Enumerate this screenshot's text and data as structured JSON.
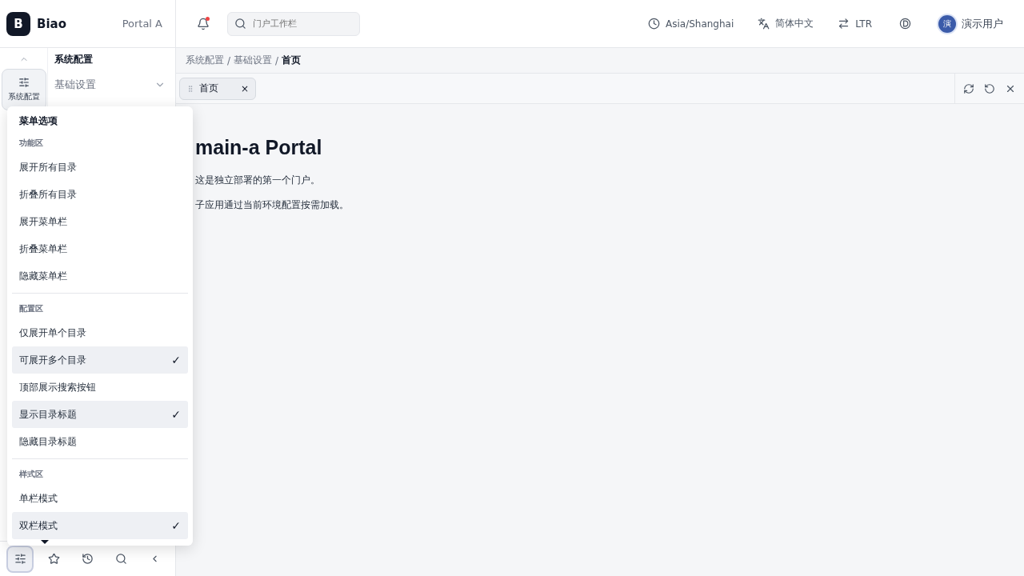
{
  "brand": {
    "logo": "B",
    "name": "Biao",
    "portal": "Portal A"
  },
  "header": {
    "notification_unread": true,
    "search": {
      "placeholder": "门户工作栏"
    },
    "timezone": "Asia/Shanghai",
    "language": "简体中文",
    "direction": "LTR",
    "user": {
      "avatar": "演",
      "name": "演示用户"
    }
  },
  "rail": {
    "items": [
      {
        "label": "系统配置",
        "selected": true
      }
    ]
  },
  "submenu": {
    "title": "系统配置",
    "items": [
      {
        "label": "基础设置",
        "expanded": false
      }
    ]
  },
  "breadcrumb": {
    "separator": "/",
    "items": [
      "系统配置",
      "基础设置",
      "首页"
    ]
  },
  "tabs": [
    {
      "label": "首页",
      "close": "×",
      "selected": true
    }
  ],
  "content": {
    "heading": "main-a Portal",
    "paragraphs": [
      "这是独立部署的第一个门户。",
      "子应用通过当前环境配置按需加载。"
    ]
  },
  "menu": {
    "title": "菜单选项",
    "check_mark": "✓",
    "sections": [
      {
        "title": "功能区",
        "items": [
          {
            "label": "展开所有目录",
            "checked": false
          },
          {
            "label": "折叠所有目录",
            "checked": false
          },
          {
            "label": "展开菜单栏",
            "checked": false
          },
          {
            "label": "折叠菜单栏",
            "checked": false
          },
          {
            "label": "隐藏菜单栏",
            "checked": false
          }
        ]
      },
      {
        "title": "配置区",
        "items": [
          {
            "label": "仅展开单个目录",
            "checked": false
          },
          {
            "label": "可展开多个目录",
            "checked": true
          },
          {
            "label": "顶部展示搜索按钮",
            "checked": false
          },
          {
            "label": "显示目录标题",
            "checked": true
          },
          {
            "label": "隐藏目录标题",
            "checked": false
          }
        ]
      },
      {
        "title": "样式区",
        "items": [
          {
            "label": "单栏模式",
            "checked": false
          },
          {
            "label": "双栏模式",
            "checked": true
          }
        ]
      }
    ]
  },
  "toolbar": [
    {
      "kind": "settings",
      "selected": true
    },
    {
      "kind": "star",
      "selected": false
    },
    {
      "kind": "history",
      "selected": false
    },
    {
      "kind": "search",
      "selected": false
    },
    {
      "kind": "collapse",
      "selected": false
    }
  ]
}
